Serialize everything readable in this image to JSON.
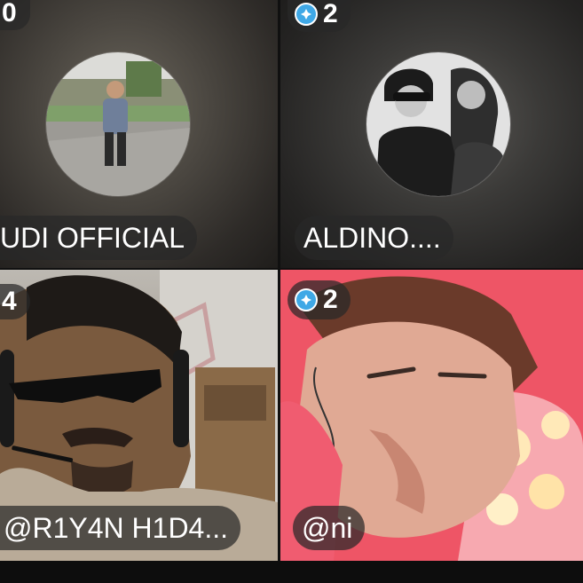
{
  "tiles": [
    {
      "badge_value": "0",
      "has_crown": false,
      "name": "UDI OFFICIAL"
    },
    {
      "badge_value": "2",
      "has_crown": true,
      "name": "ALDINO...."
    },
    {
      "badge_value": "4",
      "has_crown": false,
      "name": "@R1Y4N H1D4..."
    },
    {
      "badge_value": "2",
      "has_crown": true,
      "name": "@ni"
    }
  ],
  "icons": {
    "crown": "crown-icon"
  },
  "colors": {
    "badge_bg": "#282828",
    "crown_blue": "#3fa8e6",
    "text": "#ffffff"
  }
}
